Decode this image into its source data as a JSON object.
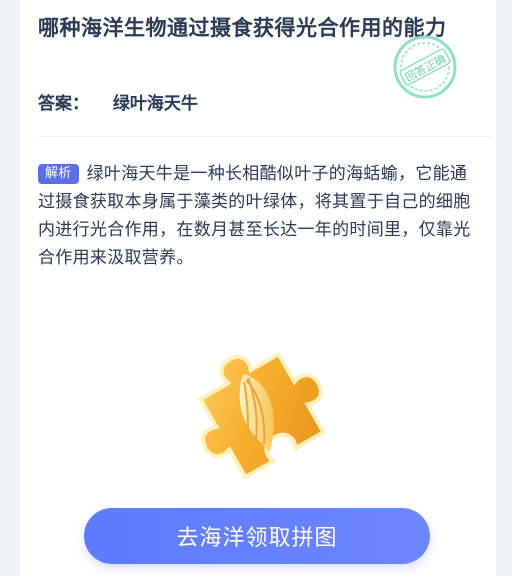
{
  "question": {
    "text": "哪种海洋生物通过摄食获得光合作用的能力"
  },
  "answer": {
    "label": "答案：",
    "value": "绿叶海天牛"
  },
  "stamp": {
    "text": "回答正确"
  },
  "explanation": {
    "tag": "解析",
    "text": "绿叶海天牛是一种长相酷似叶子的海蛞蝓，它能通过摄食获取本身属于藻类的叶绿体，将其置于自己的细胞内进行光合作用，在数月甚至长达一年的时间里，仅靠光合作用来汲取营养。"
  },
  "cta": {
    "label": "去海洋领取拼图"
  },
  "icons": {
    "puzzle": "puzzle-piece-icon",
    "stamp": "correct-answer-stamp"
  },
  "colors": {
    "accent": "#5b6ee8",
    "button": "#6280ff",
    "stamp": "#7fd8b0",
    "puzzle": "#f5b431"
  }
}
